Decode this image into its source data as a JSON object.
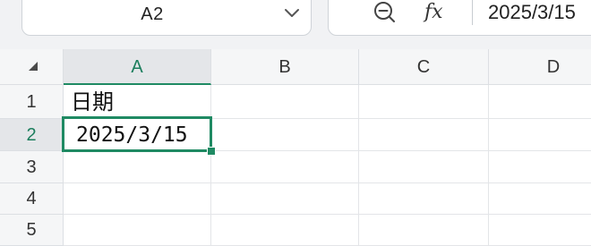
{
  "formula_bar": {
    "name_box": "A2",
    "formula_value": "2025/3/15"
  },
  "icons": {
    "name_box_dropdown": "chevron-down-icon",
    "zoom": "zoom-out-icon",
    "function": "fx-icon"
  },
  "fx_glyph": "fx",
  "columns": [
    "A",
    "B",
    "C",
    "D"
  ],
  "rows": [
    "1",
    "2",
    "3",
    "4",
    "5"
  ],
  "cells": {
    "A1": "日期",
    "A2": "2025/3/15"
  },
  "colors": {
    "accent": "#1f8a63",
    "header_bg": "#f5f6f7",
    "active_header_bg": "#e4e6e9"
  }
}
